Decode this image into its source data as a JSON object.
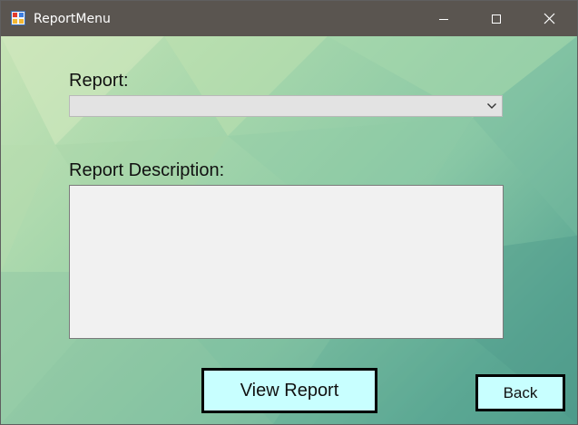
{
  "window": {
    "title": "ReportMenu",
    "app_icon": "winforms-app-icon",
    "controls": {
      "minimize_icon": "minimize-icon",
      "maximize_icon": "maximize-icon",
      "close_icon": "close-icon"
    }
  },
  "form": {
    "report_label": "Report:",
    "report_combo": {
      "selected_value": "",
      "dropdown_icon": "chevron-down-icon"
    },
    "description_label": "Report Description:",
    "description_text": ""
  },
  "buttons": {
    "view_report_label": "View Report",
    "back_label": "Back"
  },
  "colors": {
    "titlebar": "#5a5550",
    "button_fill": "#c8ffff",
    "button_border": "#000000",
    "background_light": "#c7e4b6",
    "background_dark": "#4d9a8a"
  }
}
